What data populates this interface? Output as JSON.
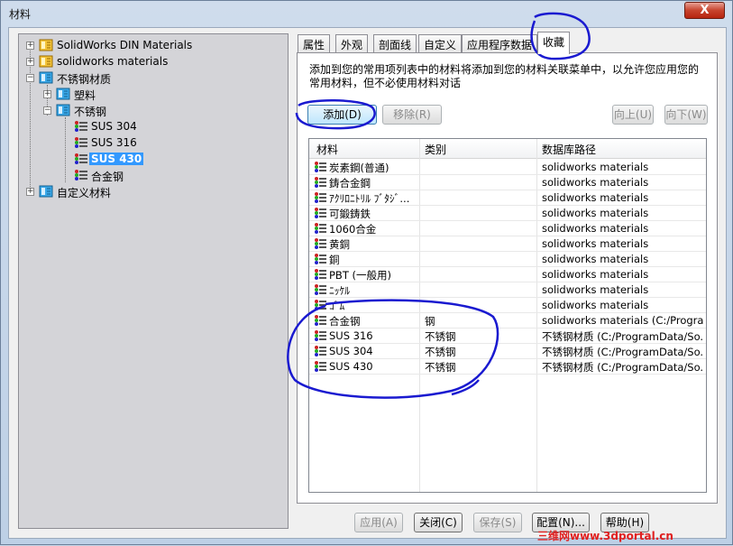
{
  "window": {
    "title": "材料",
    "close_label": "X"
  },
  "tree": {
    "items": [
      {
        "label": "SolidWorks DIN Materials",
        "expander": "+"
      },
      {
        "label": "solidworks materials",
        "expander": "+"
      },
      {
        "label": "不锈钢材质",
        "expander": "−"
      },
      {
        "label": "塑料",
        "expander": "+"
      },
      {
        "label": "不锈钢",
        "expander": "−"
      },
      {
        "label": "SUS 304"
      },
      {
        "label": "SUS 316"
      },
      {
        "label": "SUS 430",
        "selected": true
      },
      {
        "label": "合金钢"
      },
      {
        "label": "自定义材料",
        "expander": "+"
      }
    ]
  },
  "tabs": [
    "属性",
    "外观",
    "剖面线",
    "自定义",
    "应用程序数据",
    "收藏"
  ],
  "active_tab": "收藏",
  "favorites": {
    "description": "添加到您的常用项列表中的材料将添加到您的材料关联菜单中，以允许您应用您的常用材料，但不必使用材料对话",
    "add_label": "添加(D)",
    "remove_label": "移除(R)",
    "up_label": "向上(U)",
    "down_label": "向下(W)",
    "columns": [
      "材料",
      "类别",
      "数据库路径"
    ],
    "rows": [
      {
        "material": "炭素鋼(普通)",
        "category": "",
        "path": "solidworks materials"
      },
      {
        "material": "鋳合金鋼",
        "category": "",
        "path": "solidworks materials"
      },
      {
        "material": "ｱｸﾘﾛﾆﾄﾘﾙ ﾌﾞﾀｼﾞ...",
        "category": "",
        "path": "solidworks materials"
      },
      {
        "material": "可鍛鋳鉄",
        "category": "",
        "path": "solidworks materials"
      },
      {
        "material": "1060合金",
        "category": "",
        "path": "solidworks materials"
      },
      {
        "material": "黄銅",
        "category": "",
        "path": "solidworks materials"
      },
      {
        "material": "銅",
        "category": "",
        "path": "solidworks materials"
      },
      {
        "material": "PBT (一般用)",
        "category": "",
        "path": "solidworks materials"
      },
      {
        "material": "ﾆｯｹﾙ",
        "category": "",
        "path": "solidworks materials"
      },
      {
        "material": "ｺﾞﾑ",
        "category": "",
        "path": "solidworks materials"
      },
      {
        "material": "合金钢",
        "category": "钢",
        "path": "solidworks materials (C:/Program ..."
      },
      {
        "material": "SUS 316",
        "category": "不锈钢",
        "path": "不锈钢材质 (C:/ProgramData/So..."
      },
      {
        "material": "SUS 304",
        "category": "不锈钢",
        "path": "不锈钢材质 (C:/ProgramData/So..."
      },
      {
        "material": "SUS 430",
        "category": "不锈钢",
        "path": "不锈钢材质 (C:/ProgramData/So..."
      }
    ]
  },
  "footer": {
    "apply_label": "应用(A)",
    "close_label": "关闭(C)",
    "save_label": "保存(S)",
    "config_label": "配置(N)...",
    "help_label": "帮助(H)"
  },
  "watermark": "三维网www.3dportal.cn",
  "colors": {
    "annotation_ink": "#1a1ad0",
    "selection": "#3399ff"
  },
  "icons": {
    "library": "library-book-icon",
    "material": "material-stack-icon"
  }
}
